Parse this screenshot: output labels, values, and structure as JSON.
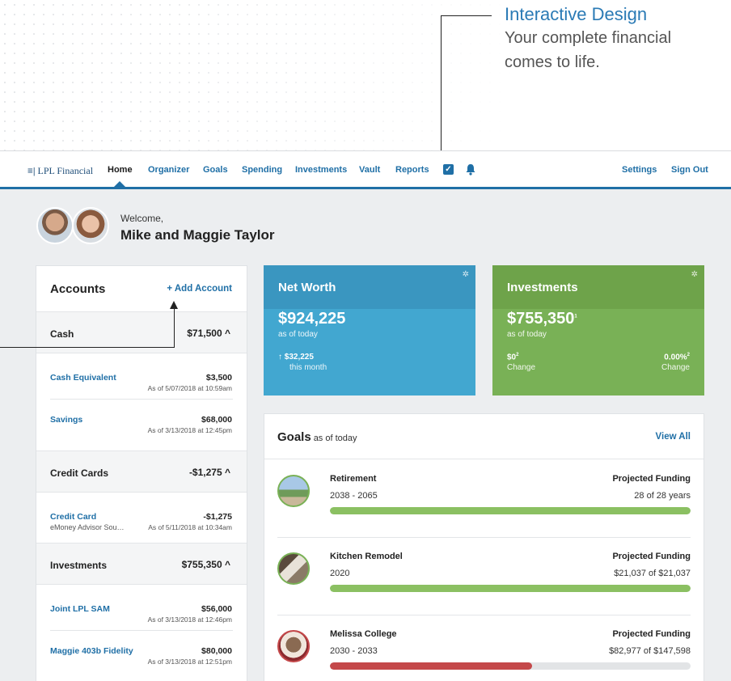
{
  "callout": {
    "title": "Interactive Design",
    "line1": "Your complete financial",
    "line2": "comes to life."
  },
  "nav": {
    "logo": "LPL Financial",
    "items": [
      "Home",
      "Organizer",
      "Goals",
      "Spending",
      "Investments",
      "Vault",
      "Reports"
    ],
    "settings": "Settings",
    "signout": "Sign Out"
  },
  "welcome": {
    "label": "Welcome,",
    "name": "Mike and Maggie Taylor"
  },
  "accounts": {
    "title": "Accounts",
    "add": "+ Add Account",
    "groups": [
      {
        "name": "Cash",
        "total": "$71,500"
      },
      {
        "name": "Credit Cards",
        "total": "-$1,275"
      },
      {
        "name": "Investments",
        "total": "$755,350"
      }
    ],
    "items": [
      {
        "name": "Cash Equivalent",
        "sub": "",
        "value": "$3,500",
        "date": "As of 5/07/2018 at 10:59am"
      },
      {
        "name": "Savings",
        "sub": "",
        "value": "$68,000",
        "date": "As of 3/13/2018 at 12:45pm"
      },
      {
        "name": "Credit Card",
        "sub": "eMoney Advisor Sou…",
        "value": "-$1,275",
        "date": "As of 5/11/2018 at 10:34am"
      },
      {
        "name": "Joint LPL SAM",
        "sub": "",
        "value": "$56,000",
        "date": "As of 3/13/2018 at 12:46pm"
      },
      {
        "name": "Maggie 403b Fidelity",
        "sub": "",
        "value": "$80,000",
        "date": "As of 3/13/2018 at 12:51pm"
      }
    ]
  },
  "networth": {
    "title": "Net Worth",
    "value": "$924,225",
    "asof": "as of today",
    "change": "$32,225",
    "change_label": "this month",
    "color": "#42a7d0"
  },
  "investments_tile": {
    "title": "Investments",
    "value": "$755,350",
    "asof": "as of today",
    "change_amount": "$0",
    "change_amount_label": "Change",
    "change_pct": "0.00%",
    "change_pct_label": "Change",
    "color": "#79b156"
  },
  "goals": {
    "title": "Goals",
    "asof": "as of today",
    "view_all": "View All",
    "items": [
      {
        "name": "Retirement",
        "years": "2038 - 2065",
        "fund_label": "Projected Funding",
        "fund_value": "28 of 28 years",
        "progress": 1.0,
        "color": "#8bc062"
      },
      {
        "name": "Kitchen Remodel",
        "years": "2020",
        "fund_label": "Projected Funding",
        "fund_value": "$21,037 of $21,037",
        "progress": 1.0,
        "color": "#8bc062"
      },
      {
        "name": "Melissa College",
        "years": "2030 - 2033",
        "fund_label": "Projected Funding",
        "fund_value": "$82,977 of $147,598",
        "progress": 0.56,
        "color": "#c4484a"
      }
    ]
  }
}
